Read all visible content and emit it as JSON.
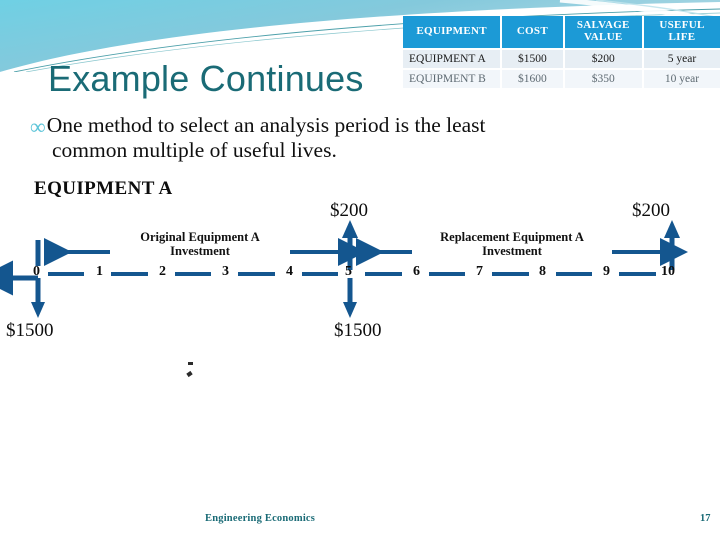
{
  "slide": {
    "title": "Example Continues",
    "accent_color": "#1A6B76",
    "banner_color": "#6FCBE0",
    "table_header_color": "#1C9AD6",
    "diagram_color": "#14568F"
  },
  "bullet": {
    "glyph": "∞",
    "line1": "One method to select an analysis period is the least",
    "line2": "common multiple of useful lives."
  },
  "table": {
    "headers": [
      "EQUIPMENT",
      "COST",
      "SALVAGE VALUE",
      "USEFUL LIFE"
    ],
    "header_cost": "COST",
    "header_equipment": "EQUIPMENT",
    "header_salvage_line1": "SALVAGE",
    "header_salvage_line2": "VALUE",
    "header_useful_line1": "USEFUL",
    "header_useful_line2": "LIFE",
    "rows": [
      {
        "equipment": "EQUIPMENT A",
        "cost": "$1500",
        "salvage": "$200",
        "life": "5 year"
      },
      {
        "equipment": "EQUIPMENT B",
        "cost": "$1600",
        "salvage": "$350",
        "life": "10 year"
      }
    ]
  },
  "diagram": {
    "heading": "EQUIPMENT A",
    "tick_labels": [
      "0",
      "1",
      "2",
      "3",
      "4",
      "5",
      "6",
      "7",
      "8",
      "9",
      "10"
    ],
    "caption_original_line1": "Original Equipment A",
    "caption_original_line2": "Investment",
    "caption_replacement_line1": "Replacement Equipment A",
    "caption_replacement_line2": "Investment",
    "salvage_label_year5": "$200",
    "salvage_label_year10": "$200",
    "cost_label_year0": "$1500",
    "cost_label_year5": "$1500"
  },
  "footer": {
    "course": "Engineering Economics",
    "page": "17"
  }
}
